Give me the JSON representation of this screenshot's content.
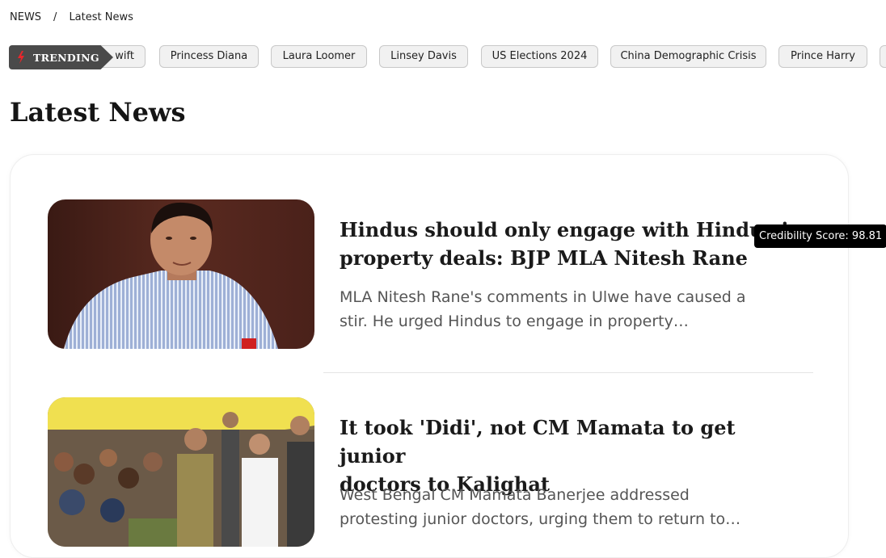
{
  "breadcrumb": {
    "home": "NEWS",
    "separator": "/",
    "current": "Latest News"
  },
  "trending": {
    "label": "TRENDING",
    "icon": "lightning-bolt-icon",
    "accent": "#e8262b",
    "chips": [
      "wift",
      "Princess Diana",
      "Laura Loomer",
      "Linsey Davis",
      "US Elections 2024",
      "China Demographic Crisis",
      "Prince Harry",
      ""
    ]
  },
  "page_title": "Latest News",
  "articles": [
    {
      "headline": "Hindus should only engage with Hindus in property deals: BJP MLA Nitesh Rane",
      "headline_line1": "Hindus should only engage with Hindus i",
      "headline_line2": "property deals: BJP MLA Nitesh Rane",
      "summary_line1": "MLA Nitesh Rane's comments in Ulwe have caused a",
      "summary_line2": "stir. He urged Hindus to engage in property…",
      "image": "man-in-striped-shirt-photo"
    },
    {
      "headline_line1": "It took 'Didi', not CM Mamata to get junior",
      "headline_line2": "doctors to Kalighat",
      "summary_line1": "West Bengal CM Mamata Banerjee addressed",
      "summary_line2": "protesting junior doctors, urging them to return to…",
      "image": "crowd-protest-photo"
    }
  ],
  "tooltip": "Credibility Score: 98.81"
}
